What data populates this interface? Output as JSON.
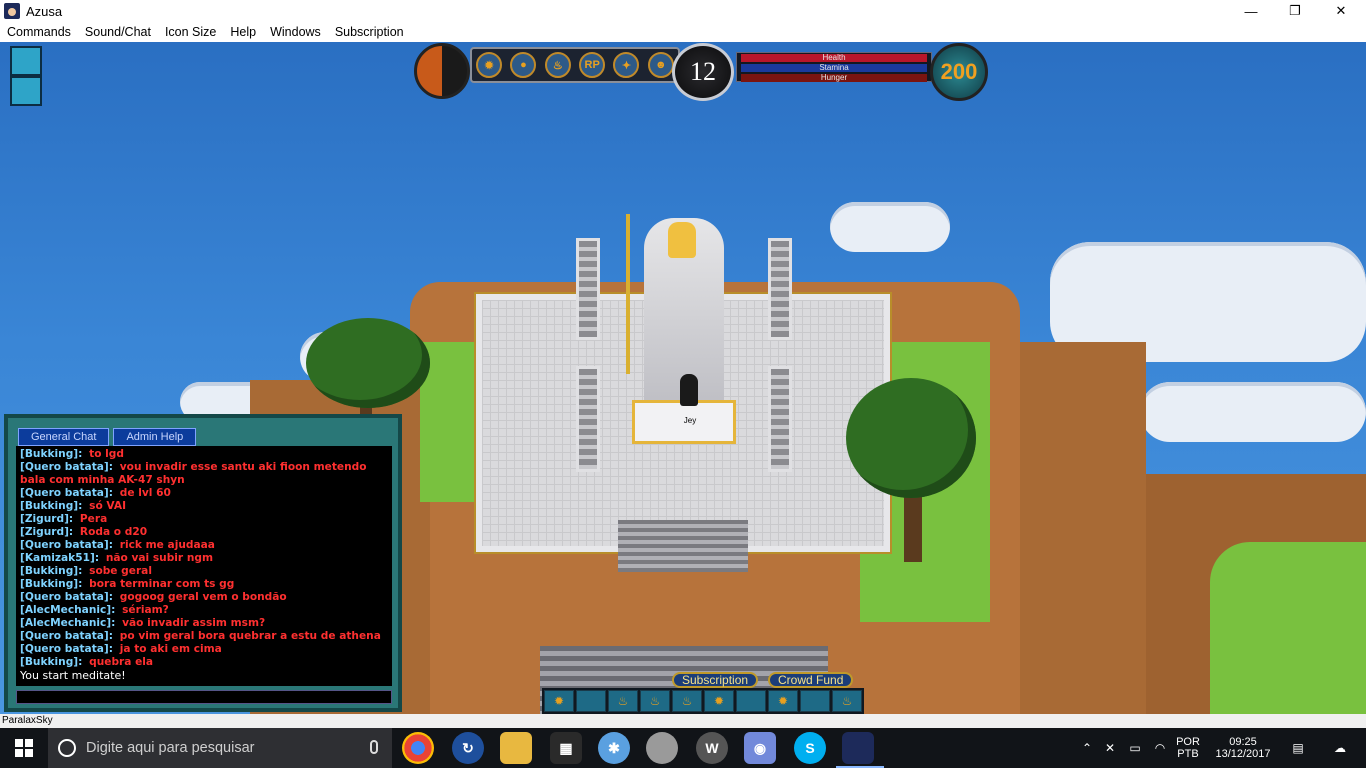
{
  "window": {
    "title": "Azusa",
    "minimize": "—",
    "maximize": "❐",
    "close": "✕"
  },
  "menu": [
    "Commands",
    "Sound/Chat",
    "Icon Size",
    "Help",
    "Windows",
    "Subscription"
  ],
  "hud": {
    "level": "12",
    "gold": "200",
    "icons": [
      "✹",
      "●",
      "♨",
      "RP",
      "✦",
      "☻"
    ],
    "bars": {
      "health": "Health",
      "stamina": "Stamina",
      "hunger": "Hunger"
    }
  },
  "player": {
    "name": "Jey"
  },
  "chat": {
    "tabs": [
      "General Chat",
      "Admin Help"
    ],
    "lines": [
      {
        "name": "[Bukking]:",
        "msg": "to lgd"
      },
      {
        "name": "[Quero batata]:",
        "msg": "vou invadir esse santu aki fioon metendo"
      },
      {
        "name": "",
        "msg": "bala com minha AK-47 shyn"
      },
      {
        "name": "[Quero batata]:",
        "msg": "de lvl 60"
      },
      {
        "name": "[Bukking]:",
        "msg": "só VAI"
      },
      {
        "name": "[Zigurd]:",
        "msg": "Pera"
      },
      {
        "name": "[Zigurd]:",
        "msg": "Roda o d20"
      },
      {
        "name": "[Quero batata]:",
        "msg": "rick me ajudaaa"
      },
      {
        "name": "[Kamizak51]:",
        "msg": "não vai subir ngm"
      },
      {
        "name": "[Bukking]:",
        "msg": "sobe geral"
      },
      {
        "name": "[Bukking]:",
        "msg": "bora terminar com ts gg"
      },
      {
        "name": "[Quero batata]:",
        "msg": "gogoog geral vem o bondão"
      },
      {
        "name": "[AlecMechanic]:",
        "msg": "sériam?"
      },
      {
        "name": "[AlecMechanic]:",
        "msg": "vão invadir assim msm?"
      },
      {
        "name": "[Quero batata]:",
        "msg": "po vim geral bora quebrar a estu de athena"
      },
      {
        "name": "[Quero batata]:",
        "msg": "ja to aki em cima"
      },
      {
        "name": "[Bukking]:",
        "msg": "quebra ela"
      }
    ],
    "system": "You start meditate!"
  },
  "buttons": {
    "subscription": "Subscription",
    "crowdfund": "Crowd Fund"
  },
  "status": "ParalaxSky",
  "taskbar": {
    "search_placeholder": "Digite aqui para pesquisar",
    "language": "POR",
    "layout": "PTB",
    "time": "09:25",
    "date": "13/12/2017",
    "apps": [
      "chrome-icon",
      "sync-icon",
      "folder-icon",
      "store-icon",
      "network-icon",
      "disc-icon",
      "w-icon",
      "discord-icon",
      "skype-icon",
      "azusa-icon"
    ]
  },
  "colors": {
    "chat_name": "#7fd3ff",
    "chat_msg": "#ff3030",
    "sky": "#3a86d6"
  }
}
